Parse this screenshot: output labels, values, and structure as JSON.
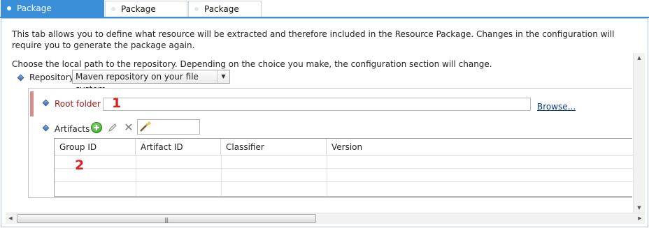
{
  "tabs": [
    {
      "label": "Package configuration",
      "active": true
    },
    {
      "label": "Package content",
      "active": false
    },
    {
      "label": "Package alerts",
      "active": false
    }
  ],
  "description": "This tab allows you to define what resource will be extracted and therefore included in the Resource Package. Changes in the configuration will require you to generate the package again.",
  "hint": "Choose the local path to the repository. Depending on the choice you make, the configuration section will change.",
  "repository": {
    "label": "Repository",
    "selected": "Maven repository on your file system"
  },
  "root_folder": {
    "label": "Root folder",
    "value": "",
    "browse_label": "Browse..."
  },
  "artifacts": {
    "label": "Artifacts",
    "toolbar_icons": [
      "add-icon",
      "edit-icon",
      "delete-icon",
      "wand-icon"
    ],
    "filter_value": "",
    "columns": [
      "Group ID",
      "Artifact ID",
      "Classifier",
      "Version"
    ],
    "rows": []
  },
  "annotations": {
    "marker_1": "1",
    "marker_2": "2"
  },
  "colors": {
    "accent": "#3b8fd8",
    "required_label": "#9b1a1a",
    "marker": "#e01e1e",
    "link": "#0b3a8a"
  }
}
